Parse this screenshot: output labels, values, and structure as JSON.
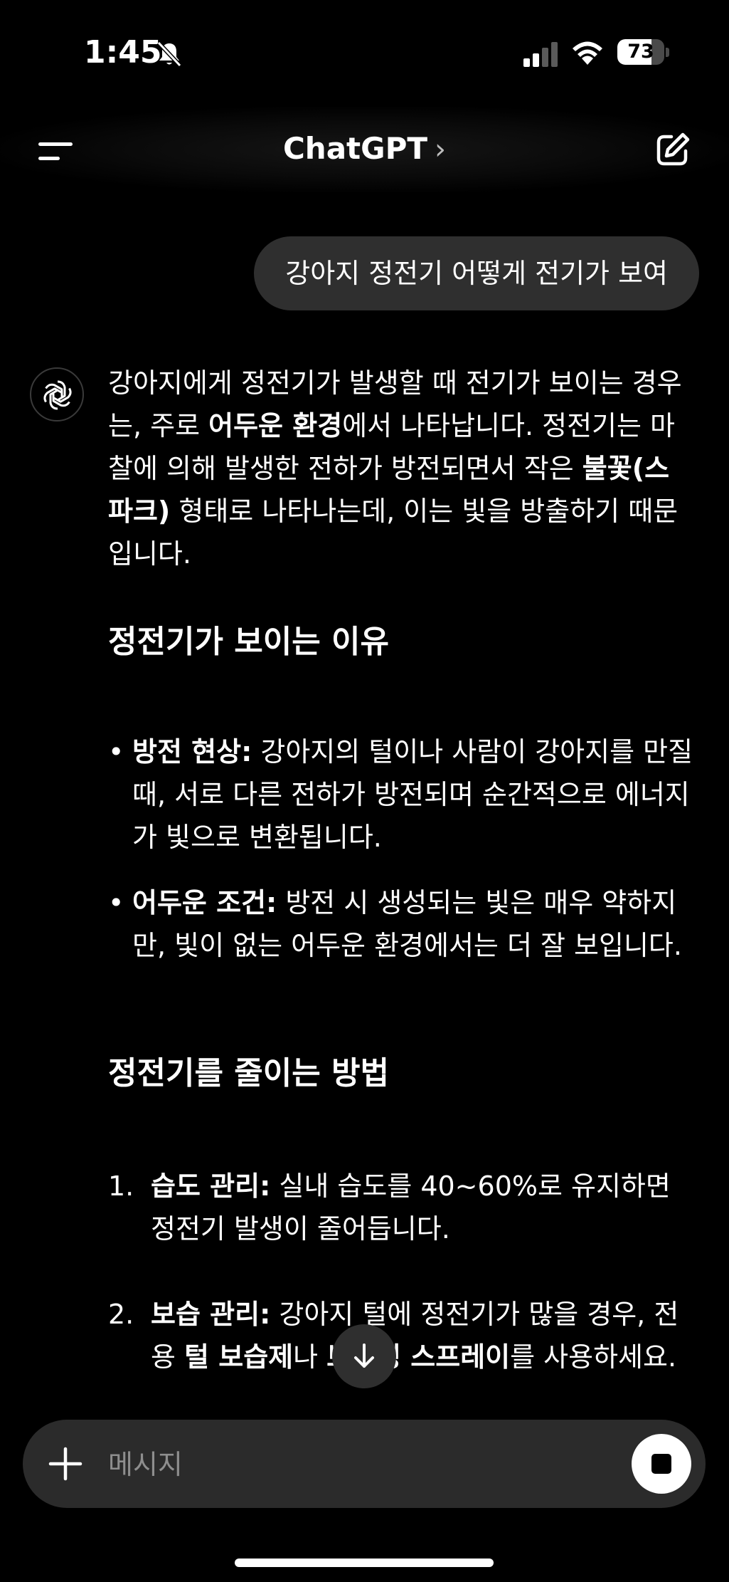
{
  "status_bar": {
    "time": "1:45",
    "battery_level": "73",
    "battery_fraction": 0.73
  },
  "header": {
    "title": "ChatGPT",
    "title_chevron": "›"
  },
  "conversation": {
    "user_message": "강아지 정전기 어떻게 전기가 보여",
    "assistant": {
      "intro": [
        {
          "text": "강아지에게 정전기가 발생할 때 전기가 보이는 경우는, 주로 ",
          "bold": false
        },
        {
          "text": "어두운 환경",
          "bold": true
        },
        {
          "text": "에서 나타납니다. 정전기는 마찰에 의해 발생한 전하가 방전되면서 작은 ",
          "bold": false
        },
        {
          "text": "불꽃(스파크)",
          "bold": true
        },
        {
          "text": " 형태로 나타나는데, 이는 빛을 방출하기 때문입니다.",
          "bold": false
        }
      ],
      "section1_heading": "정전기가 보이는 이유",
      "bullets": [
        {
          "marker": "•",
          "label": "방전 현상:",
          "text": " 강아지의 털이나 사람이 강아지를 만질 때, 서로 다른 전하가 방전되며 순간적으로 에너지가 빛으로 변환됩니다."
        },
        {
          "marker": "•",
          "label": "어두운 조건:",
          "text": " 방전 시 생성되는 빛은 매우 약하지만, 빛이 없는 어두운 환경에서는 더 잘 보입니다."
        }
      ],
      "section2_heading": "정전기를 줄이는 방법",
      "numbered": [
        {
          "marker": "1.",
          "parts": [
            {
              "text": "습도 관리:",
              "bold": true
            },
            {
              "text": " 실내 습도를 40~60%로 유지하면 정전기 발생이 줄어듭니다.",
              "bold": false
            }
          ]
        },
        {
          "marker": "2.",
          "parts": [
            {
              "text": "보습 관리:",
              "bold": true
            },
            {
              "text": " 강아지 털에 정전기가 많을 경우, 전용 ",
              "bold": false
            },
            {
              "text": "털 보습제",
              "bold": true
            },
            {
              "text": "나 ",
              "bold": false
            },
            {
              "text": "브러싱 스프레이",
              "bold": true
            },
            {
              "text": "를 사용하세요.",
              "bold": false
            }
          ]
        }
      ]
    }
  },
  "composer": {
    "placeholder": "메시지"
  },
  "icons": {
    "menu": "menu-icon",
    "compose": "compose-icon",
    "avatar": "openai-logo-icon",
    "scroll_down": "arrow-down-icon",
    "add": "plus-icon",
    "stop": "stop-icon",
    "mute": "bell-slash-icon",
    "signal": "signal-icon",
    "wifi": "wifi-icon"
  },
  "colors": {
    "background": "#000000",
    "bubble": "#2f2f2f",
    "composer": "#2b2b2b",
    "text": "#ffffff",
    "placeholder": "#8e8e8e"
  }
}
